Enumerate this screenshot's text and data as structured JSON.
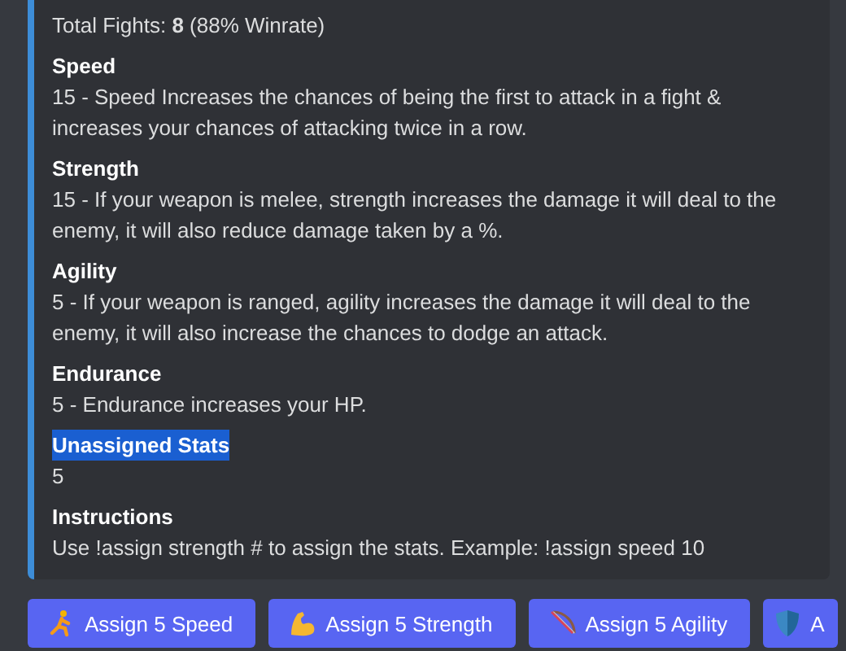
{
  "embed": {
    "summary": "Total Fights: **8** (88% Winrate)",
    "fields": [
      {
        "name": "Speed",
        "value": "15 - Speed Increases the chances of being the first to attack in a fight & increases your chances of attacking twice in a row.",
        "selected": false
      },
      {
        "name": "Strength",
        "value": "15 - If your weapon is melee, strength increases the damage it will deal to the enemy, it will also reduce damage taken by a %.",
        "selected": false
      },
      {
        "name": "Agility",
        "value": "5 - If your weapon is ranged, agility increases the damage it will deal to the enemy, it will also increase the chances to dodge an attack.",
        "selected": false
      },
      {
        "name": "Endurance",
        "value": "5 - Endurance increases your HP.",
        "selected": false
      },
      {
        "name": "Unassigned Stats",
        "value": "5",
        "selected": true
      },
      {
        "name": "Instructions",
        "value": "Use !assign strength # to assign the stats. Example: !assign speed 10",
        "selected": false
      }
    ]
  },
  "buttons": [
    {
      "kind": "runner",
      "label": "Assign 5 Speed"
    },
    {
      "kind": "arm",
      "label": "Assign 5 Strength"
    },
    {
      "kind": "bow",
      "label": "Assign 5 Agility"
    },
    {
      "kind": "shield",
      "label": "A"
    }
  ]
}
